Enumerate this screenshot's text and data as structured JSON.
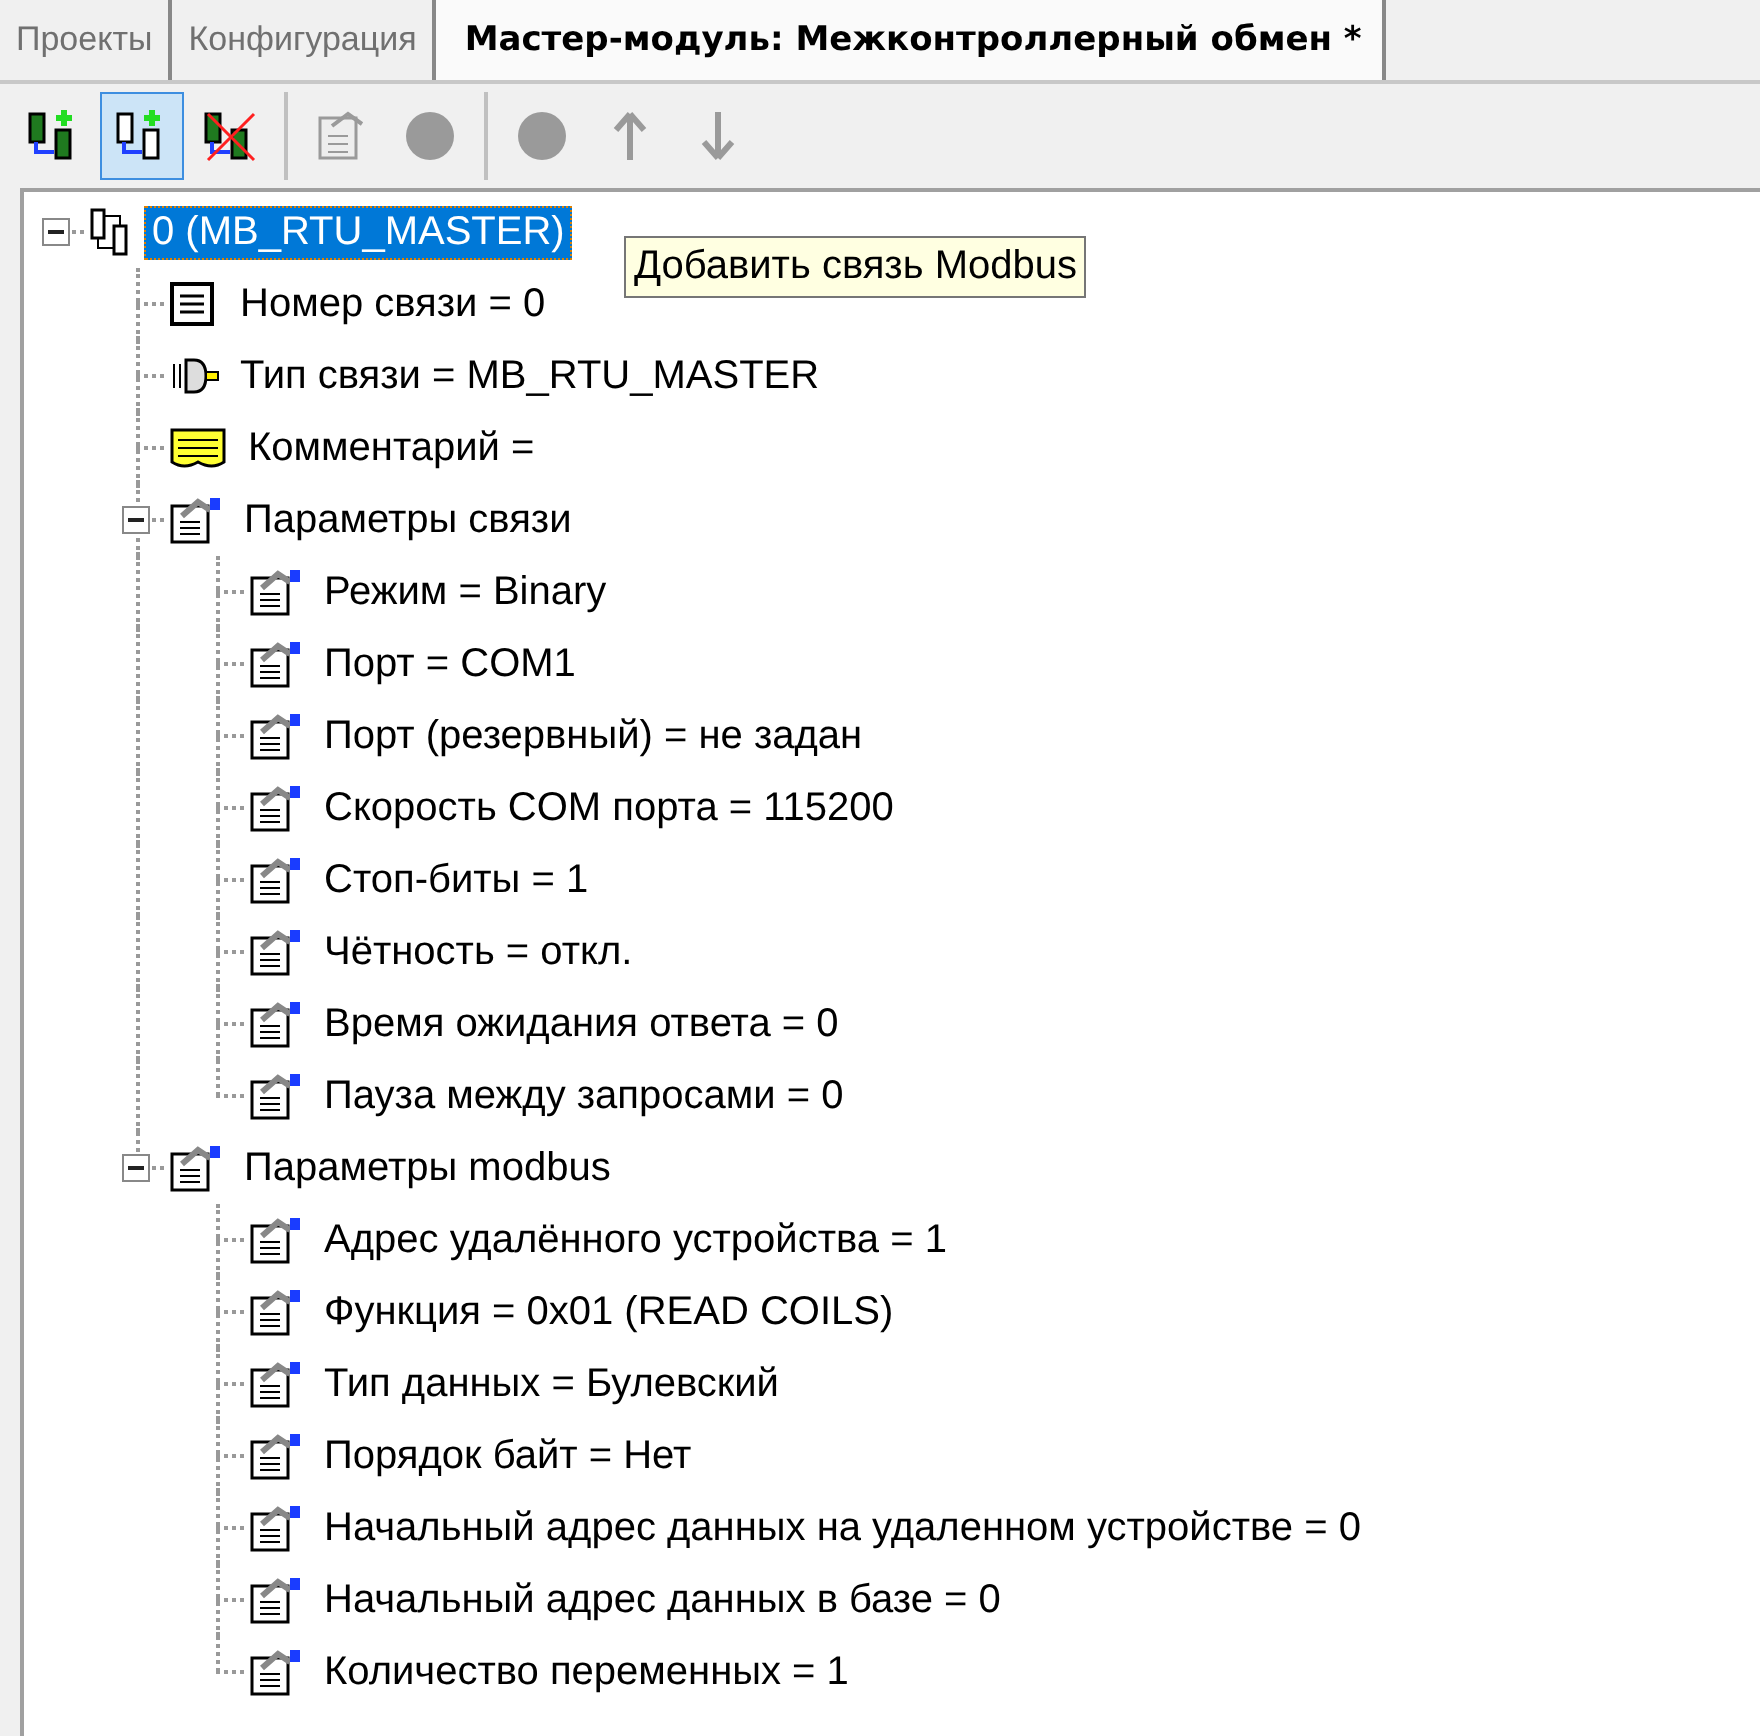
{
  "tabs": [
    {
      "label": "Проекты",
      "selected": false
    },
    {
      "label": "Конфигурация",
      "selected": false
    },
    {
      "label": "Мастер-модуль: Межконтроллерный обмен *",
      "selected": true
    }
  ],
  "toolbar": [
    [
      {
        "kind": "add-link",
        "disabled": false,
        "selected": false
      },
      {
        "kind": "copy-link",
        "disabled": false,
        "selected": true
      },
      {
        "kind": "delete-link",
        "disabled": false,
        "selected": false
      }
    ],
    [
      {
        "kind": "properties",
        "disabled": true,
        "selected": false
      },
      {
        "kind": "circle",
        "disabled": true,
        "selected": false
      }
    ],
    [
      {
        "kind": "circle",
        "disabled": true,
        "selected": false
      },
      {
        "kind": "arrow-up",
        "disabled": true,
        "selected": false
      },
      {
        "kind": "arrow-down",
        "disabled": true,
        "selected": false
      }
    ]
  ],
  "tooltip": {
    "text": "Добавить связь Modbus"
  },
  "tree": [
    {
      "label": "0 (MB_RTU_MASTER)",
      "kind": "module",
      "selected": true,
      "expanded": true,
      "children": [
        {
          "label": "Номер связи = 0",
          "kind": "record",
          "selected": false
        },
        {
          "label": "Тип связи = MB_RTU_MASTER",
          "kind": "plug",
          "selected": false
        },
        {
          "label": "Комментарий =",
          "kind": "comment",
          "selected": false
        },
        {
          "label": "Параметры связи",
          "kind": "props",
          "selected": false,
          "expanded": true,
          "children": [
            {
              "label": "Режим = Binary",
              "kind": "props",
              "selected": false
            },
            {
              "label": "Порт = COM1",
              "kind": "props",
              "selected": false
            },
            {
              "label": "Порт (резервный) = не задан",
              "kind": "props",
              "selected": false
            },
            {
              "label": "Скорость COM порта = 115200",
              "kind": "props",
              "selected": false
            },
            {
              "label": "Стоп-биты = 1",
              "kind": "props",
              "selected": false
            },
            {
              "label": "Чётность = откл.",
              "kind": "props",
              "selected": false
            },
            {
              "label": "Время ожидания ответа = 0",
              "kind": "props",
              "selected": false
            },
            {
              "label": "Пауза между запросами = 0",
              "kind": "props",
              "selected": false
            }
          ]
        },
        {
          "label": "Параметры modbus",
          "kind": "props",
          "selected": false,
          "expanded": true,
          "children": [
            {
              "label": "Адрес удалённого устройства = 1",
              "kind": "props",
              "selected": false
            },
            {
              "label": "Функция = 0x01 (READ COILS)",
              "kind": "props",
              "selected": false
            },
            {
              "label": "Тип данных = Булевский",
              "kind": "props",
              "selected": false
            },
            {
              "label": "Порядок байт = Нет",
              "kind": "props",
              "selected": false
            },
            {
              "label": "Начальный адрес данных на удаленном устройстве = 0",
              "kind": "props",
              "selected": false
            },
            {
              "label": "Начальный адрес данных в базе = 0",
              "kind": "props",
              "selected": false
            },
            {
              "label": "Количество переменных = 1",
              "kind": "props",
              "selected": false
            }
          ]
        }
      ]
    }
  ]
}
